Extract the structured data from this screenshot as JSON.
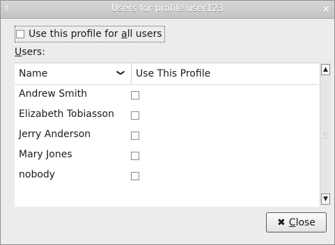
{
  "window": {
    "title": "Users for profile user123",
    "title_icon": "moon-icon",
    "close_glyph": "×"
  },
  "all_users": {
    "prefix": "Use this profile for ",
    "mnemonic": "a",
    "suffix": "ll users",
    "checked": false
  },
  "users_label": {
    "mnemonic": "U",
    "rest": "sers:"
  },
  "table": {
    "columns": [
      {
        "label": "Name",
        "sort_indicator": "❯"
      },
      {
        "label": "Use This Profile"
      }
    ],
    "rows": [
      {
        "name": "Andrew Smith",
        "checked": false
      },
      {
        "name": "Elizabeth Tobiasson",
        "checked": false
      },
      {
        "name": "Jerry Anderson",
        "checked": false
      },
      {
        "name": "Mary Jones",
        "checked": false
      },
      {
        "name": "nobody",
        "checked": false
      }
    ]
  },
  "scrollbar": {
    "up_glyph": "▲",
    "down_glyph": "▼"
  },
  "close_button": {
    "icon_glyph": "✖",
    "mnemonic": "C",
    "rest": "lose"
  }
}
